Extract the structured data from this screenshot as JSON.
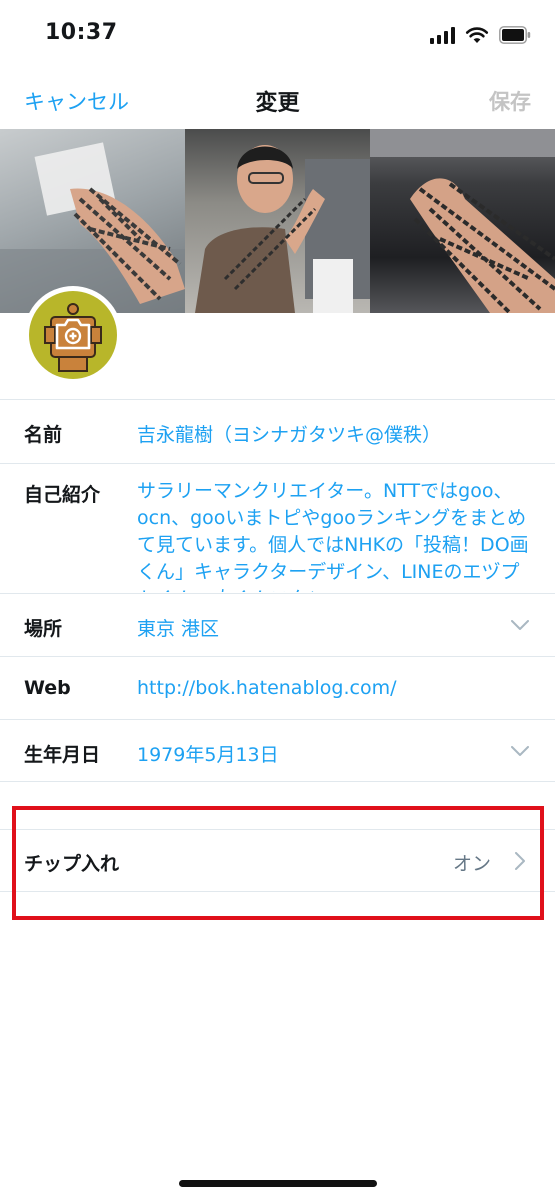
{
  "status_bar": {
    "time": "10:37"
  },
  "nav": {
    "cancel": "キャンセル",
    "title": "変更",
    "save": "保存"
  },
  "profile": {
    "name_label": "名前",
    "name_value": "吉永龍樹（ヨシナガタツキ@僕秩）",
    "bio_label": "自己紹介",
    "bio_value": "サラリーマンクリエイター。NTTではgoo、ocn、gooいまトピやgooランキングをまとめて見ています。個人ではNHKの「投稿！DO画くん」キャラクターデザイン、LINEのエヅプトくん、肉くんスタン",
    "location_label": "場所",
    "location_value": "東京 港区",
    "web_label": "Web",
    "web_value": "http://bok.hatenablog.com/",
    "birthday_label": "生年月日",
    "birthday_value": "1979年5月13日"
  },
  "tip_jar": {
    "label": "チップ入れ",
    "value": "オン"
  },
  "colors": {
    "accent": "#1da1f2",
    "highlight": "#e0101a",
    "disabled": "#c4c4c4"
  },
  "icons": [
    "signal-icon",
    "wifi-icon",
    "battery-icon",
    "camera-plus-icon",
    "chevron-down-icon",
    "chevron-right-icon"
  ]
}
